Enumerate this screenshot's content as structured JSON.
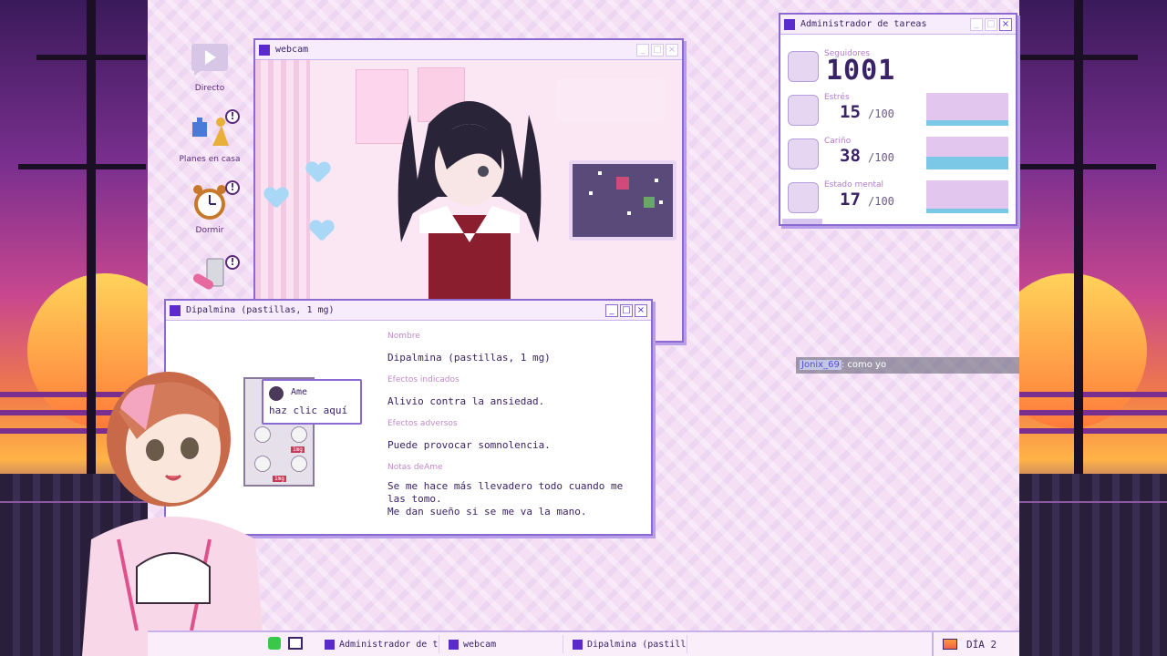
{
  "desktop_icons": [
    {
      "label": "Directo",
      "icon": "play-icon"
    },
    {
      "label": "Planes en casa",
      "icon": "puzzle-icon"
    },
    {
      "label": "Dormir",
      "icon": "alarm-clock-icon"
    },
    {
      "label": "",
      "icon": "pill-icon"
    }
  ],
  "webcam": {
    "title": "webcam"
  },
  "medicine": {
    "title": "Dipalmina (pastillas, 1 mg)",
    "fields": {
      "name_label": "Nombre",
      "name_value": "Dipalmina (pastillas, 1 mg)",
      "effects_label": "Efectos indicados",
      "effects_value": "Alivio contra la ansiedad.",
      "adverse_label": "Efectos adversos",
      "adverse_value": "Puede provocar somnolencia.",
      "notes_label": "Notas deAme",
      "notes_value": "Se me hace más llevadero todo cuando me\nlas tomo.\nMe dan sueño si se me va la mano."
    },
    "tooltip": {
      "name": "Ame",
      "message": "haz clic aquí"
    },
    "pill_dose": "1mg"
  },
  "task_manager": {
    "title": "Administrador de tareas",
    "followers_label": "Seguidores",
    "followers_value": "1001",
    "stats": [
      {
        "label": "Estrés",
        "value": "15",
        "max": "/100",
        "level": 0.15
      },
      {
        "label": "Cariño",
        "value": "38",
        "max": "/100",
        "level": 0.38
      },
      {
        "label": "Estado mental",
        "value": "17",
        "max": "/100",
        "level": 0.17
      }
    ]
  },
  "chat": {
    "user": "Jonix_69",
    "message": ": como yo"
  },
  "taskbar": {
    "items": [
      "Administrador de tar...",
      "webcam",
      "Dipalmina (pastillas, 1..."
    ],
    "day": "DÍA 2"
  },
  "colors": {
    "accent": "#5a2acc",
    "border": "#8a6ad0",
    "meter": "#7ac8e6"
  }
}
